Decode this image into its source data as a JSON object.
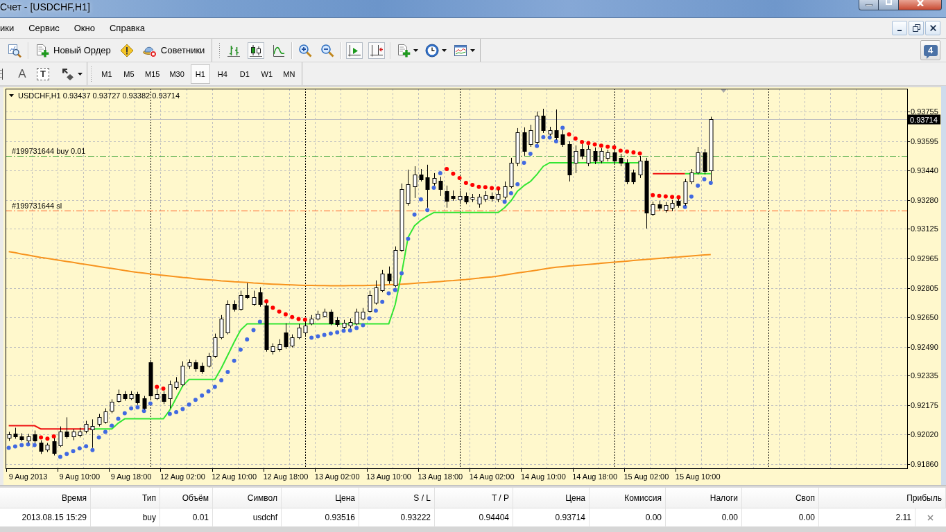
{
  "window": {
    "title": "Счет - [USDCHF,H1]"
  },
  "menu": [
    {
      "label": "ики"
    },
    {
      "label": "Сервис"
    },
    {
      "label": "Окно"
    },
    {
      "label": "Справка"
    }
  ],
  "standard_toolbar": {
    "groups": [
      [
        {
          "kind": "tester"
        }
      ],
      [
        {
          "kind": "order",
          "label": "Новый Ордер"
        },
        {
          "kind": "warning"
        },
        {
          "kind": "experts",
          "label": "Советники"
        }
      ]
    ]
  },
  "charts_toolbar": {
    "groups": [
      [
        {
          "kind": "bars",
          "pressed": false
        },
        {
          "kind": "candles",
          "pressed": true
        },
        {
          "kind": "line",
          "pressed": false
        }
      ],
      [
        {
          "kind": "zoomin",
          "pressed": false
        },
        {
          "kind": "zoomout",
          "pressed": false
        }
      ],
      [
        {
          "kind": "shift",
          "pressed": true
        },
        {
          "kind": "autoscroll",
          "pressed": true
        }
      ],
      [
        {
          "kind": "newchart",
          "pressed": false,
          "dropdown": true
        },
        {
          "kind": "periods",
          "pressed": false,
          "dropdown": true
        },
        {
          "kind": "indicators",
          "pressed": false,
          "dropdown": true
        }
      ]
    ]
  },
  "messages": {
    "count": "4"
  },
  "objects_toolbar": {
    "items": [
      {
        "kind": "fibo"
      },
      {
        "kind": "text",
        "label": "A"
      },
      {
        "kind": "label",
        "label": "T"
      },
      {
        "kind": "arrows",
        "dropdown": true
      }
    ]
  },
  "periods_toolbar": {
    "items": [
      {
        "label": "M1",
        "selected": false
      },
      {
        "label": "M5",
        "selected": false
      },
      {
        "label": "M15",
        "selected": false
      },
      {
        "label": "M30",
        "selected": false
      },
      {
        "label": "H1",
        "selected": true
      },
      {
        "label": "H4",
        "selected": false
      },
      {
        "label": "D1",
        "selected": false
      },
      {
        "label": "W1",
        "selected": false
      },
      {
        "label": "MN",
        "selected": false
      }
    ]
  },
  "chart": {
    "chart_data": [
      {
        "type": "candlestick",
        "title": "USDCHF,H1 0.93437 0.93727 0.93382 0.93714",
        "categories": [
          null,
          null,
          null,
          "9 Aug 2013",
          null,
          null,
          null,
          null,
          null,
          null,
          null,
          "9 Aug 10:00",
          null,
          null,
          null,
          null,
          null,
          null,
          null,
          "9 Aug 18:00",
          null,
          null,
          null,
          null,
          null,
          null,
          null,
          "12 Aug 02:00",
          null,
          null,
          null,
          null,
          null,
          null,
          null,
          "12 Aug 10:00",
          null,
          null,
          null,
          null,
          null,
          null,
          null,
          "12 Aug 18:00",
          null,
          null,
          null,
          null,
          null,
          null,
          null,
          "13 Aug 02:00",
          null,
          null,
          null,
          null,
          null,
          null,
          null,
          "13 Aug 10:00",
          null,
          null,
          null,
          null,
          null,
          null,
          null,
          "13 Aug 18:00",
          null,
          null,
          null,
          null,
          null,
          null,
          null,
          "14 Aug 02:00",
          null,
          null,
          null,
          null,
          null,
          null,
          null,
          "14 Aug 10:00",
          null,
          null,
          null,
          null,
          null,
          null,
          null,
          "14 Aug 18:00",
          null,
          null,
          null,
          null,
          null,
          null,
          null,
          "15 Aug 02:00",
          null,
          null,
          null,
          null,
          null,
          null,
          null,
          "15 Aug 10:00",
          null,
          null,
          null,
          null,
          null,
          null,
          null,
          null,
          null,
          null,
          null,
          null,
          null,
          null,
          null,
          null,
          null,
          null,
          null,
          null,
          null,
          null,
          null,
          null,
          null,
          null,
          null,
          null,
          null,
          null,
          null,
          null
        ],
        "ohlc": [
          [
            0.91999,
            0.92033,
            0.91984,
            0.92018
          ],
          [
            0.92025,
            0.92055,
            0.91996,
            0.9201
          ],
          [
            0.9201,
            0.92025,
            0.91981,
            0.91996
          ],
          [
            0.91984,
            0.92022,
            0.91973,
            0.92007
          ],
          [
            0.92018,
            0.9204,
            0.91973,
            0.91984
          ],
          [
            0.91973,
            0.91988,
            0.91914,
            0.91929
          ],
          [
            0.91936,
            0.91973,
            0.91925,
            0.91962
          ],
          [
            0.91984,
            0.91999,
            0.91906,
            0.91921
          ],
          [
            0.91962,
            0.92062,
            0.91951,
            0.92036
          ],
          [
            0.92036,
            0.92111,
            0.91996,
            0.9201
          ],
          [
            0.92007,
            0.92048,
            0.91988,
            0.92033
          ],
          [
            0.92018,
            0.92055,
            0.92003,
            0.92036
          ],
          [
            0.92036,
            0.92092,
            0.92025,
            0.92074
          ],
          [
            0.92048,
            0.921,
            0.91947,
            0.92066
          ],
          [
            0.92074,
            0.92129,
            0.92062,
            0.92111
          ],
          [
            0.92089,
            0.92159,
            0.92077,
            0.92144
          ],
          [
            0.92144,
            0.92208,
            0.92133,
            0.92193
          ],
          [
            0.922,
            0.9226,
            0.92189,
            0.92237
          ],
          [
            0.92237,
            0.92252,
            0.922,
            0.92215
          ],
          [
            0.92215,
            0.92252,
            0.92204,
            0.92237
          ],
          [
            0.92234,
            0.92248,
            0.92178,
            0.92189
          ],
          [
            0.92215,
            0.92226,
            0.92152,
            0.92163
          ],
          [
            0.92405,
            0.9242,
            0.92204,
            0.92226
          ],
          [
            0.92215,
            0.92263,
            0.92204,
            0.92237
          ],
          [
            0.92237,
            0.92252,
            0.92182,
            0.922
          ],
          [
            0.92215,
            0.92308,
            0.92159,
            0.92289
          ],
          [
            0.92271,
            0.92327,
            0.9226,
            0.92301
          ],
          [
            0.92289,
            0.92412,
            0.92278,
            0.9239
          ],
          [
            0.92386,
            0.92423,
            0.92371,
            0.92405
          ],
          [
            0.92405,
            0.9242,
            0.92356,
            0.92371
          ],
          [
            0.9239,
            0.92405,
            0.92345,
            0.9236
          ],
          [
            0.9239,
            0.92457,
            0.92379,
            0.92442
          ],
          [
            0.92442,
            0.92561,
            0.92431,
            0.92542
          ],
          [
            0.92542,
            0.92661,
            0.92531,
            0.92643
          ],
          [
            0.92568,
            0.9274,
            0.92557,
            0.92721
          ],
          [
            0.92721,
            0.9274,
            0.9268,
            0.92695
          ],
          [
            0.92695,
            0.92792,
            0.92684,
            0.92769
          ],
          [
            0.92769,
            0.92833,
            0.92747,
            0.92758
          ],
          [
            0.92721,
            0.92792,
            0.9271,
            0.92758
          ],
          [
            0.92784,
            0.9281,
            0.92706,
            0.92721
          ],
          [
            0.92713,
            0.92725,
            0.92464,
            0.92479
          ],
          [
            0.92468,
            0.92509,
            0.92449,
            0.92494
          ],
          [
            0.92479,
            0.92531,
            0.92464,
            0.92505
          ],
          [
            0.92568,
            0.92617,
            0.92479,
            0.92494
          ],
          [
            0.92498,
            0.92557,
            0.92487,
            0.92542
          ],
          [
            0.92542,
            0.92613,
            0.92531,
            0.92594
          ],
          [
            0.92568,
            0.92624,
            0.92554,
            0.92606
          ],
          [
            0.92617,
            0.92661,
            0.92606,
            0.92643
          ],
          [
            0.92643,
            0.92684,
            0.92632,
            0.92669
          ],
          [
            0.92658,
            0.92695,
            0.92647,
            0.9268
          ],
          [
            0.9268,
            0.92691,
            0.92606,
            0.92617
          ],
          [
            0.92635,
            0.9265,
            0.92598,
            0.92613
          ],
          [
            0.92598,
            0.92635,
            0.92587,
            0.9262
          ],
          [
            0.92606,
            0.92643,
            0.92591,
            0.92624
          ],
          [
            0.92617,
            0.92695,
            0.92606,
            0.9268
          ],
          [
            0.92643,
            0.92699,
            0.92632,
            0.9268
          ],
          [
            0.92684,
            0.92792,
            0.92673,
            0.92769
          ],
          [
            0.92728,
            0.92847,
            0.92717,
            0.9281
          ],
          [
            0.92795,
            0.92903,
            0.92784,
            0.92885
          ],
          [
            0.92885,
            0.92922,
            0.92829,
            0.92847
          ],
          [
            0.92821,
            0.9303,
            0.9281,
            0.93011
          ],
          [
            0.93011,
            0.93368,
            0.93,
            0.93338
          ],
          [
            0.93264,
            0.93443,
            0.93249,
            0.93364
          ],
          [
            0.93353,
            0.93461,
            0.9329,
            0.93417
          ],
          [
            0.93417,
            0.93446,
            0.93379,
            0.93391
          ],
          [
            0.93402,
            0.93469,
            0.93238,
            0.93338
          ],
          [
            0.93372,
            0.93424,
            0.93357,
            0.93398
          ],
          [
            0.93383,
            0.93405,
            0.93301,
            0.93338
          ],
          [
            0.93327,
            0.93357,
            0.93238,
            0.93275
          ],
          [
            0.93301,
            0.93331,
            0.93275,
            0.9329
          ],
          [
            0.93283,
            0.93331,
            0.93257,
            0.93301
          ],
          [
            0.93301,
            0.9332,
            0.93257,
            0.93271
          ],
          [
            0.93286,
            0.93312,
            0.93268,
            0.93294
          ],
          [
            0.9326,
            0.93312,
            0.93238,
            0.93298
          ],
          [
            0.93286,
            0.93327,
            0.93268,
            0.93305
          ],
          [
            0.93301,
            0.9332,
            0.93271,
            0.9329
          ],
          [
            0.93286,
            0.93335,
            0.93268,
            0.93312
          ],
          [
            0.93298,
            0.93379,
            0.93283,
            0.93353
          ],
          [
            0.93353,
            0.93506,
            0.93342,
            0.9348
          ],
          [
            0.9348,
            0.93666,
            0.93461,
            0.93643
          ],
          [
            0.93643,
            0.9367,
            0.93517,
            0.93543
          ],
          [
            0.9358,
            0.93684,
            0.93565,
            0.93655
          ],
          [
            0.93591,
            0.93755,
            0.9358,
            0.93733
          ],
          [
            0.93733,
            0.9377,
            0.9364,
            0.93655
          ],
          [
            0.93636,
            0.93673,
            0.93625,
            0.93655
          ],
          [
            0.93655,
            0.93766,
            0.93603,
            0.93617
          ],
          [
            0.93632,
            0.93655,
            0.93565,
            0.9358
          ],
          [
            0.9358,
            0.93595,
            0.93379,
            0.93417
          ],
          [
            0.9348,
            0.93573,
            0.93424,
            0.93543
          ],
          [
            0.93554,
            0.9358,
            0.93498,
            0.93517
          ],
          [
            0.9348,
            0.93573,
            0.93461,
            0.93554
          ],
          [
            0.93543,
            0.93562,
            0.93472,
            0.93491
          ],
          [
            0.93491,
            0.93558,
            0.93476,
            0.93543
          ],
          [
            0.93506,
            0.9355,
            0.93487,
            0.93536
          ],
          [
            0.93536,
            0.93554,
            0.93476,
            0.93491
          ],
          [
            0.93506,
            0.93528,
            0.93461,
            0.9348
          ],
          [
            0.9348,
            0.93498,
            0.93364,
            0.93379
          ],
          [
            0.93428,
            0.93443,
            0.93364,
            0.93379
          ],
          [
            0.93417,
            0.93517,
            0.93398,
            0.93491
          ],
          [
            0.93491,
            0.93506,
            0.93126,
            0.93212
          ],
          [
            0.93205,
            0.93271,
            0.93193,
            0.93257
          ],
          [
            0.93257,
            0.93275,
            0.93223,
            0.93238
          ],
          [
            0.93227,
            0.93268,
            0.93212,
            0.93253
          ],
          [
            0.93238,
            0.93279,
            0.93219,
            0.93264
          ],
          [
            0.93275,
            0.93285,
            0.93238,
            0.93253
          ],
          [
            0.93264,
            0.93394,
            0.93249,
            0.93379
          ],
          [
            0.93379,
            0.93446,
            0.93364,
            0.93428
          ],
          [
            0.93428,
            0.93565,
            0.93417,
            0.93536
          ],
          [
            0.93536,
            0.93554,
            0.93417,
            0.93437
          ],
          [
            0.93437,
            0.93727,
            0.93382,
            0.93714
          ],
          null,
          null,
          null,
          null,
          null,
          null,
          null,
          null,
          null,
          null,
          null,
          null,
          null,
          null,
          null,
          null,
          null,
          null,
          null,
          null,
          null,
          null,
          null,
          null,
          null,
          null,
          null,
          null,
          null,
          null
        ],
        "series": [
          {
            "type": "line",
            "color": "#f7931e",
            "values": [
              0.93002,
              0.92996,
              0.92989,
              0.92983,
              0.92977,
              0.9297,
              0.92965,
              0.9296,
              0.92954,
              0.92949,
              0.92944,
              0.92938,
              0.92933,
              0.92927,
              0.92922,
              0.92916,
              0.92911,
              0.92906,
              0.929,
              0.92895,
              0.9289,
              0.92886,
              0.92882,
              0.92878,
              0.92874,
              0.9287,
              0.92867,
              0.92863,
              0.9286,
              0.92856,
              0.92853,
              0.9285,
              0.92848,
              0.92845,
              0.92843,
              0.9284,
              0.92838,
              0.92836,
              0.92833,
              0.92831,
              0.92829,
              0.92827,
              0.92826,
              0.92824,
              0.92823,
              0.92821,
              0.9282,
              0.9282,
              0.92819,
              0.92819,
              0.92818,
              0.92818,
              0.92818,
              0.92819,
              0.92819,
              0.92819,
              0.9282,
              0.92821,
              0.92822,
              0.92824,
              0.92825,
              0.92827,
              0.92829,
              0.92831,
              0.92834,
              0.92836,
              0.92839,
              0.92841,
              0.92844,
              0.92846,
              0.92849,
              0.92852,
              0.92856,
              0.92859,
              0.92863,
              0.92866,
              0.92871,
              0.92876,
              0.92882,
              0.92887,
              0.92892,
              0.92897,
              0.92902,
              0.92908,
              0.92913,
              0.92918,
              0.92921,
              0.92924,
              0.92927,
              0.9293,
              0.92933,
              0.92936,
              0.92939,
              0.92942,
              0.92945,
              0.92948,
              0.92951,
              0.92954,
              0.92957,
              0.9296,
              0.92963,
              0.92966,
              0.92968,
              0.92971,
              0.92973,
              0.92976,
              0.92979,
              0.92981,
              0.92984,
              0.92986,
              null,
              null,
              null,
              null,
              null,
              null,
              null,
              null,
              null,
              null,
              null,
              null,
              null,
              null,
              null,
              null,
              null,
              null,
              null,
              null,
              null,
              null,
              null,
              null,
              null,
              null,
              null,
              null,
              null,
              null
            ]
          },
          {
            "type": "line",
            "color": "#33e633",
            "values": [
              null,
              null,
              null,
              null,
              null,
              null,
              null,
              null,
              null,
              null,
              null,
              null,
              null,
              0.92048,
              0.92048,
              0.92048,
              0.92048,
              0.9208,
              0.92103,
              0.92103,
              0.92103,
              0.92103,
              0.92103,
              0.92103,
              0.92103,
              0.9215,
              0.92215,
              0.9228,
              0.92315,
              0.92315,
              0.92315,
              0.92315,
              0.92315,
              0.92375,
              0.92445,
              0.92515,
              0.9258,
              0.92613,
              0.92613,
              0.92613,
              0.92613,
              0.92613,
              0.92613,
              0.92613,
              0.92613,
              0.92613,
              0.92613,
              0.92613,
              0.92613,
              0.92613,
              0.92613,
              0.92613,
              0.92613,
              0.92613,
              0.92613,
              0.92613,
              0.92613,
              0.92613,
              0.92613,
              0.92613,
              0.92717,
              0.92885,
              0.93078,
              0.93141,
              0.93171,
              0.93193,
              0.93212,
              0.93212,
              0.93212,
              0.93212,
              0.93212,
              0.93212,
              0.93212,
              0.93212,
              0.93212,
              0.93212,
              0.93212,
              0.93238,
              0.93275,
              0.93327,
              0.93357,
              0.93379,
              0.93417,
              0.93461,
              0.9348,
              0.9348,
              0.9348,
              0.9348,
              0.9348,
              0.9348,
              0.9348,
              0.9348,
              0.9348,
              0.9348,
              0.9348,
              0.9348,
              0.9348,
              0.9348,
              0.9348,
              null,
              null,
              null,
              null,
              null,
              null,
              0.93421,
              0.93421,
              0.93421,
              0.93421,
              0.93421,
              null,
              null,
              null,
              null,
              null,
              null,
              null,
              null,
              null,
              null,
              null,
              null,
              null,
              null,
              null,
              null,
              null,
              null,
              null,
              null,
              null,
              null,
              null,
              null,
              null,
              null,
              null,
              null,
              null,
              null
            ]
          },
          {
            "type": "line",
            "color": "#ee1111",
            "values": [
              0.92066,
              0.92066,
              0.92066,
              0.92066,
              0.92066,
              0.92048,
              0.92048,
              0.92048,
              0.92048,
              0.92048,
              0.92048,
              0.92048,
              0.92048,
              0.92048,
              null,
              null,
              null,
              null,
              null,
              null,
              null,
              null,
              null,
              null,
              null,
              null,
              null,
              null,
              null,
              null,
              null,
              null,
              null,
              null,
              null,
              null,
              null,
              null,
              null,
              null,
              null,
              null,
              null,
              null,
              null,
              null,
              null,
              null,
              null,
              null,
              null,
              null,
              null,
              null,
              null,
              null,
              null,
              null,
              null,
              null,
              null,
              null,
              null,
              null,
              null,
              null,
              null,
              null,
              null,
              null,
              null,
              null,
              null,
              null,
              null,
              null,
              null,
              null,
              null,
              null,
              null,
              null,
              null,
              null,
              null,
              null,
              null,
              null,
              null,
              null,
              null,
              null,
              null,
              null,
              null,
              null,
              null,
              null,
              null,
              null,
              0.93421,
              0.93421,
              0.93421,
              0.93421,
              0.93421,
              0.93421,
              null,
              null,
              null,
              null,
              null,
              null,
              null,
              null,
              null,
              null,
              null,
              null,
              null,
              null,
              null,
              null,
              null,
              null,
              null,
              null,
              null,
              null,
              null,
              null,
              null,
              null,
              null,
              null,
              null,
              null,
              null,
              null,
              null,
              null
            ]
          },
          {
            "type": "scatter",
            "color": "#4169e1",
            "values": [
              0.91947,
              0.91954,
              0.91962,
              0.91965,
              0.91962,
              null,
              null,
              null,
              0.91899,
              0.91914,
              0.91929,
              0.91944,
              0.91955,
              0.91935,
              0.92003,
              0.92033,
              0.92066,
              0.92103,
              0.92133,
              0.92159,
              0.92165,
              0.92145,
              0.92185,
              null,
              null,
              0.92129,
              0.92139,
              0.92155,
              0.9218,
              0.92205,
              0.92228,
              0.9225,
              0.92275,
              0.9231,
              0.92355,
              0.92415,
              0.92475,
              0.9253,
              0.9258,
              0.92625,
              null,
              null,
              null,
              null,
              null,
              null,
              null,
              0.92539,
              0.92546,
              0.92554,
              0.92561,
              0.92568,
              0.92576,
              0.92578,
              0.92591,
              0.92606,
              0.92643,
              0.92684,
              0.92732,
              0.92777,
              0.92795,
              0.92885,
              0.93071,
              0.93201,
              0.93283,
              0.93225,
              0.93345,
              0.93424,
              null,
              null,
              null,
              null,
              null,
              null,
              null,
              null,
              null,
              0.9327,
              0.93316,
              0.93364,
              0.9348,
              0.93528,
              0.9357,
              0.93617,
              0.93615,
              0.93595,
              0.93668,
              null,
              null,
              null,
              null,
              null,
              null,
              null,
              null,
              null,
              null,
              null,
              null,
              null,
              null,
              null,
              null,
              null,
              null,
              0.93242,
              0.93298,
              0.93357,
              0.93391,
              0.93372,
              null,
              null,
              null,
              null,
              null,
              null,
              null,
              null,
              null,
              null,
              null,
              null,
              null,
              null,
              null,
              null,
              null,
              null,
              null,
              null,
              null,
              null,
              null,
              null,
              null,
              null,
              null,
              null,
              null,
              null
            ]
          },
          {
            "type": "scatter",
            "color": "#ff0000",
            "values": [
              null,
              null,
              null,
              null,
              null,
              0.92003,
              0.91996,
              0.92008,
              null,
              null,
              null,
              null,
              null,
              null,
              null,
              null,
              null,
              null,
              null,
              null,
              null,
              null,
              null,
              0.92275,
              0.92265,
              null,
              null,
              null,
              null,
              null,
              null,
              null,
              null,
              null,
              null,
              null,
              null,
              null,
              null,
              null,
              0.92735,
              0.927,
              0.9268,
              0.92665,
              0.9265,
              0.9264,
              0.92636,
              null,
              null,
              null,
              null,
              null,
              null,
              null,
              null,
              null,
              null,
              null,
              null,
              null,
              null,
              null,
              null,
              null,
              null,
              null,
              null,
              null,
              0.93446,
              0.93421,
              0.93398,
              0.93372,
              0.9336,
              0.9335,
              0.93348,
              0.93344,
              0.93342,
              null,
              null,
              null,
              null,
              null,
              null,
              null,
              null,
              null,
              null,
              0.93632,
              0.9361,
              0.93591,
              0.93586,
              0.93578,
              0.93572,
              0.93566,
              0.93562,
              0.93545,
              0.9354,
              0.93535,
              0.9353,
              null,
              0.93305,
              0.93302,
              0.93299,
              0.93296,
              0.93294,
              null,
              null,
              null,
              null,
              null,
              null,
              null,
              null,
              null,
              null,
              null,
              null,
              null,
              null,
              null,
              null,
              null,
              null,
              null,
              null,
              null,
              null,
              null,
              null,
              null,
              null,
              null,
              null,
              null,
              null,
              null,
              null,
              null,
              null,
              null
            ]
          }
        ],
        "ylim": [
          0.91837,
          0.93878
        ],
        "yticks": [
          {
            "value": 0.93755,
            "label": "0.93755"
          },
          {
            "value": 0.93595,
            "label": "0.93595"
          },
          {
            "value": 0.9344,
            "label": "0.93440"
          },
          {
            "value": 0.9328,
            "label": "0.93280"
          },
          {
            "value": 0.93125,
            "label": "0.93125"
          },
          {
            "value": 0.92965,
            "label": "0.92965"
          },
          {
            "value": 0.92805,
            "label": "0.92805"
          },
          {
            "value": 0.9265,
            "label": "0.92650"
          },
          {
            "value": 0.9249,
            "label": "0.92490"
          },
          {
            "value": 0.92335,
            "label": "0.92335"
          },
          {
            "value": 0.92175,
            "label": "0.92175"
          },
          {
            "value": 0.9202,
            "label": "0.92020"
          },
          {
            "value": 0.9186,
            "label": "0.91860"
          }
        ],
        "grid": true,
        "ref_lines": [
          {
            "axis": "y",
            "value": 0.93714,
            "label": "0.93714",
            "color": "#c0c0c0",
            "line_style": "solid"
          },
          {
            "axis": "y",
            "value": 0.93516,
            "label": "#199731644 buy 0.01",
            "color": "#2e9e2e",
            "line_style": "dashdot"
          },
          {
            "axis": "y",
            "value": 0.93222,
            "label": "#199731644 sl",
            "color": "#ff5a1e",
            "line_style": "dashdot"
          }
        ]
      }
    ]
  },
  "table": {
    "columns": [
      "Время",
      "Тип",
      "Объём",
      "Символ",
      "Цена",
      "S / L",
      "T / P",
      "Цена",
      "Комиссия",
      "Налоги",
      "Своп",
      "Прибыль"
    ],
    "rows": [
      {
        "cells": [
          "2013.08.15 15:29",
          "buy",
          "0.01",
          "usdchf",
          "0.93516",
          "0.93222",
          "0.94404",
          "0.93714",
          "0.00",
          "0.00",
          "0.00",
          "2.11"
        ]
      }
    ]
  }
}
